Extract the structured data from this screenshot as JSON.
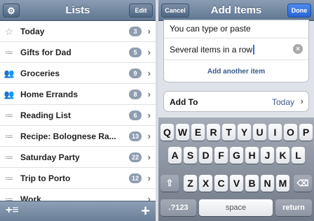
{
  "left_panel": {
    "title": "Lists",
    "settings_icon": "gear-icon",
    "edit_label": "Edit",
    "items": [
      {
        "label": "Today",
        "count": "3",
        "icon": "star-icon"
      },
      {
        "label": "Gifts for Dad",
        "count": "5",
        "icon": "list-icon"
      },
      {
        "label": "Groceries",
        "count": "9",
        "icon": "shared-list-icon"
      },
      {
        "label": "Home Errands",
        "count": "8",
        "icon": "shared-list-icon"
      },
      {
        "label": "Reading List",
        "count": "6",
        "icon": "list-icon"
      },
      {
        "label": "Recipe: Bolognese Ra...",
        "count": "13",
        "icon": "list-icon"
      },
      {
        "label": "Saturday Party",
        "count": "22",
        "icon": "list-icon"
      },
      {
        "label": "Trip to Porto",
        "count": "12",
        "icon": "list-icon"
      },
      {
        "label": "Work",
        "count": "",
        "icon": "list-icon"
      }
    ],
    "bottom_left_icon": "add-list-icon",
    "bottom_right_icon": "plus-icon"
  },
  "right_panel": {
    "title": "Add Items",
    "cancel_label": "Cancel",
    "done_label": "Done",
    "line1": "You can type or paste",
    "line2": "Several items in a row",
    "add_another": "Add another item",
    "add_to_label": "Add To",
    "add_to_value": "Today",
    "keyboard": {
      "row1": [
        "Q",
        "W",
        "E",
        "R",
        "T",
        "Y",
        "U",
        "I",
        "O",
        "P"
      ],
      "row2": [
        "A",
        "S",
        "D",
        "F",
        "G",
        "H",
        "J",
        "K",
        "L"
      ],
      "row3": [
        "Z",
        "X",
        "C",
        "V",
        "B",
        "N",
        "M"
      ],
      "numbers_label": ".?123",
      "space_label": "space",
      "return_label": "return"
    }
  }
}
